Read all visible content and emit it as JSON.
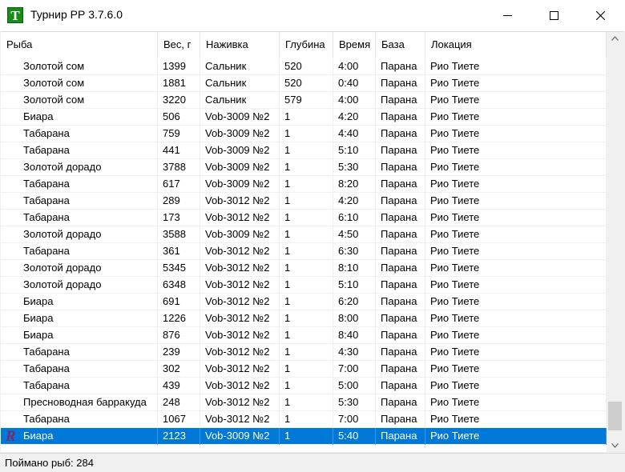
{
  "window": {
    "title": "Турнир РР 3.7.6.0",
    "icon_letter": "T"
  },
  "table": {
    "columns": [
      "Рыба",
      "Вес, г",
      "Наживка",
      "Глубина",
      "Время",
      "База",
      "Локация"
    ],
    "rows": [
      [
        "Золотой сом",
        "1399",
        "Сальник",
        "520",
        "4:00",
        "Парана",
        "Рио Тиете"
      ],
      [
        "Золотой сом",
        "1881",
        "Сальник",
        "520",
        "0:40",
        "Парана",
        "Рио Тиете"
      ],
      [
        "Золотой сом",
        "3220",
        "Сальник",
        "579",
        "4:00",
        "Парана",
        "Рио Тиете"
      ],
      [
        "Биара",
        "506",
        "Vob-3009 №2",
        "1",
        "4:20",
        "Парана",
        "Рио Тиете"
      ],
      [
        "Табарана",
        "759",
        "Vob-3009 №2",
        "1",
        "4:40",
        "Парана",
        "Рио Тиете"
      ],
      [
        "Табарана",
        "441",
        "Vob-3009 №2",
        "1",
        "5:10",
        "Парана",
        "Рио Тиете"
      ],
      [
        "Золотой дорадо",
        "3788",
        "Vob-3009 №2",
        "1",
        "5:30",
        "Парана",
        "Рио Тиете"
      ],
      [
        "Табарана",
        "617",
        "Vob-3009 №2",
        "1",
        "8:20",
        "Парана",
        "Рио Тиете"
      ],
      [
        "Табарана",
        "289",
        "Vob-3012 №2",
        "1",
        "4:20",
        "Парана",
        "Рио Тиете"
      ],
      [
        "Табарана",
        "173",
        "Vob-3012 №2",
        "1",
        "6:10",
        "Парана",
        "Рио Тиете"
      ],
      [
        "Золотой дорадо",
        "3588",
        "Vob-3009 №2",
        "1",
        "4:50",
        "Парана",
        "Рио Тиете"
      ],
      [
        "Табарана",
        "361",
        "Vob-3012 №2",
        "1",
        "6:30",
        "Парана",
        "Рио Тиете"
      ],
      [
        "Золотой дорадо",
        "5345",
        "Vob-3012 №2",
        "1",
        "8:10",
        "Парана",
        "Рио Тиете"
      ],
      [
        "Золотой дорадо",
        "6348",
        "Vob-3012 №2",
        "1",
        "5:10",
        "Парана",
        "Рио Тиете"
      ],
      [
        "Биара",
        "691",
        "Vob-3012 №2",
        "1",
        "6:20",
        "Парана",
        "Рио Тиете"
      ],
      [
        "Биара",
        "1226",
        "Vob-3012 №2",
        "1",
        "8:00",
        "Парана",
        "Рио Тиете"
      ],
      [
        "Биара",
        "876",
        "Vob-3012 №2",
        "1",
        "8:40",
        "Парана",
        "Рио Тиете"
      ],
      [
        "Табарана",
        "239",
        "Vob-3012 №2",
        "1",
        "4:30",
        "Парана",
        "Рио Тиете"
      ],
      [
        "Табарана",
        "302",
        "Vob-3012 №2",
        "1",
        "7:00",
        "Парана",
        "Рио Тиете"
      ],
      [
        "Табарана",
        "439",
        "Vob-3012 №2",
        "1",
        "5:00",
        "Парана",
        "Рио Тиете"
      ],
      [
        "Пресноводная барракуда",
        "248",
        "Vob-3012 №2",
        "1",
        "5:30",
        "Парана",
        "Рио Тиете"
      ],
      [
        "Табарана",
        "1067",
        "Vob-3012 №2",
        "1",
        "7:00",
        "Парана",
        "Рио Тиете"
      ],
      [
        "Биара",
        "2123",
        "Vob-3009 №2",
        "1",
        "5:40",
        "Парана",
        "Рио Тиете"
      ]
    ],
    "selected_row": 22,
    "selected_row_icon": "R"
  },
  "status": {
    "caught_label": "Поймано рыб: 284"
  },
  "colors": {
    "selection": "#0078d7",
    "app_icon": "#1a8a1a",
    "record_icon": "#7a2a6e"
  },
  "icons": {
    "app": "app-icon",
    "minimize": "minimize-icon",
    "maximize": "maximize-icon",
    "close": "close-icon",
    "scroll_up": "chevron-up-icon",
    "scroll_down": "chevron-down-icon",
    "record": "record-fish-icon"
  }
}
